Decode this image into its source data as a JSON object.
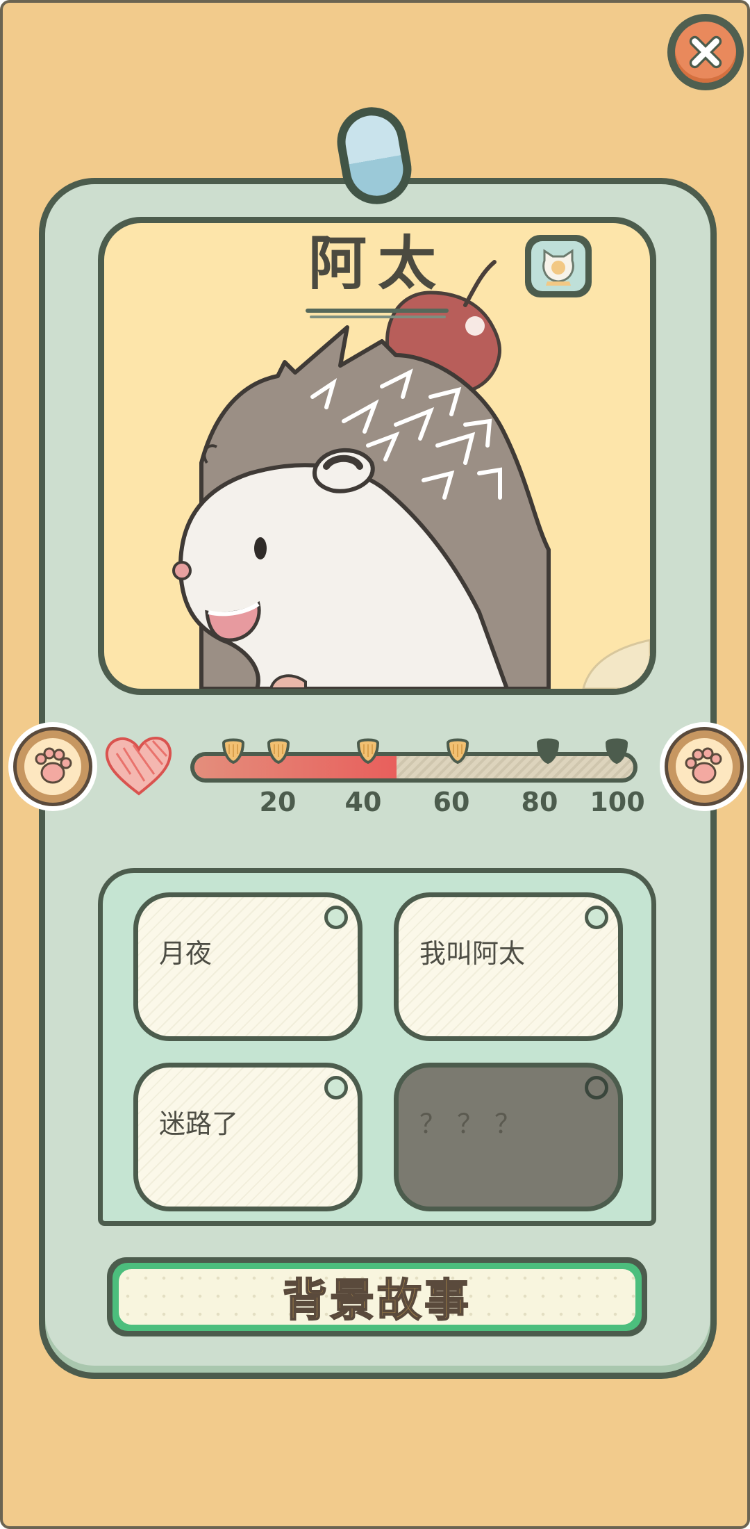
{
  "character": {
    "name": "阿太",
    "badge_icon": "cat-face-icon"
  },
  "affection": {
    "icon": "heart-icon",
    "value_fraction": 0.46,
    "ticks": [
      "20",
      "40",
      "60",
      "80",
      "100"
    ],
    "markers_unlocked": [
      true,
      true,
      true,
      true,
      false,
      false
    ]
  },
  "memories": [
    {
      "label": "月夜",
      "locked": false
    },
    {
      "label": "我叫阿太",
      "locked": false
    },
    {
      "label": "迷路了",
      "locked": false
    },
    {
      "label": "？？？",
      "locked": true
    }
  ],
  "story_button": {
    "label": "背景故事"
  },
  "colors": {
    "background": "#f2cb8c",
    "card": "#cddecf",
    "outline": "#4c5c4d",
    "affection_fill": "#e85f5c",
    "story_border": "#4cbe7d"
  }
}
